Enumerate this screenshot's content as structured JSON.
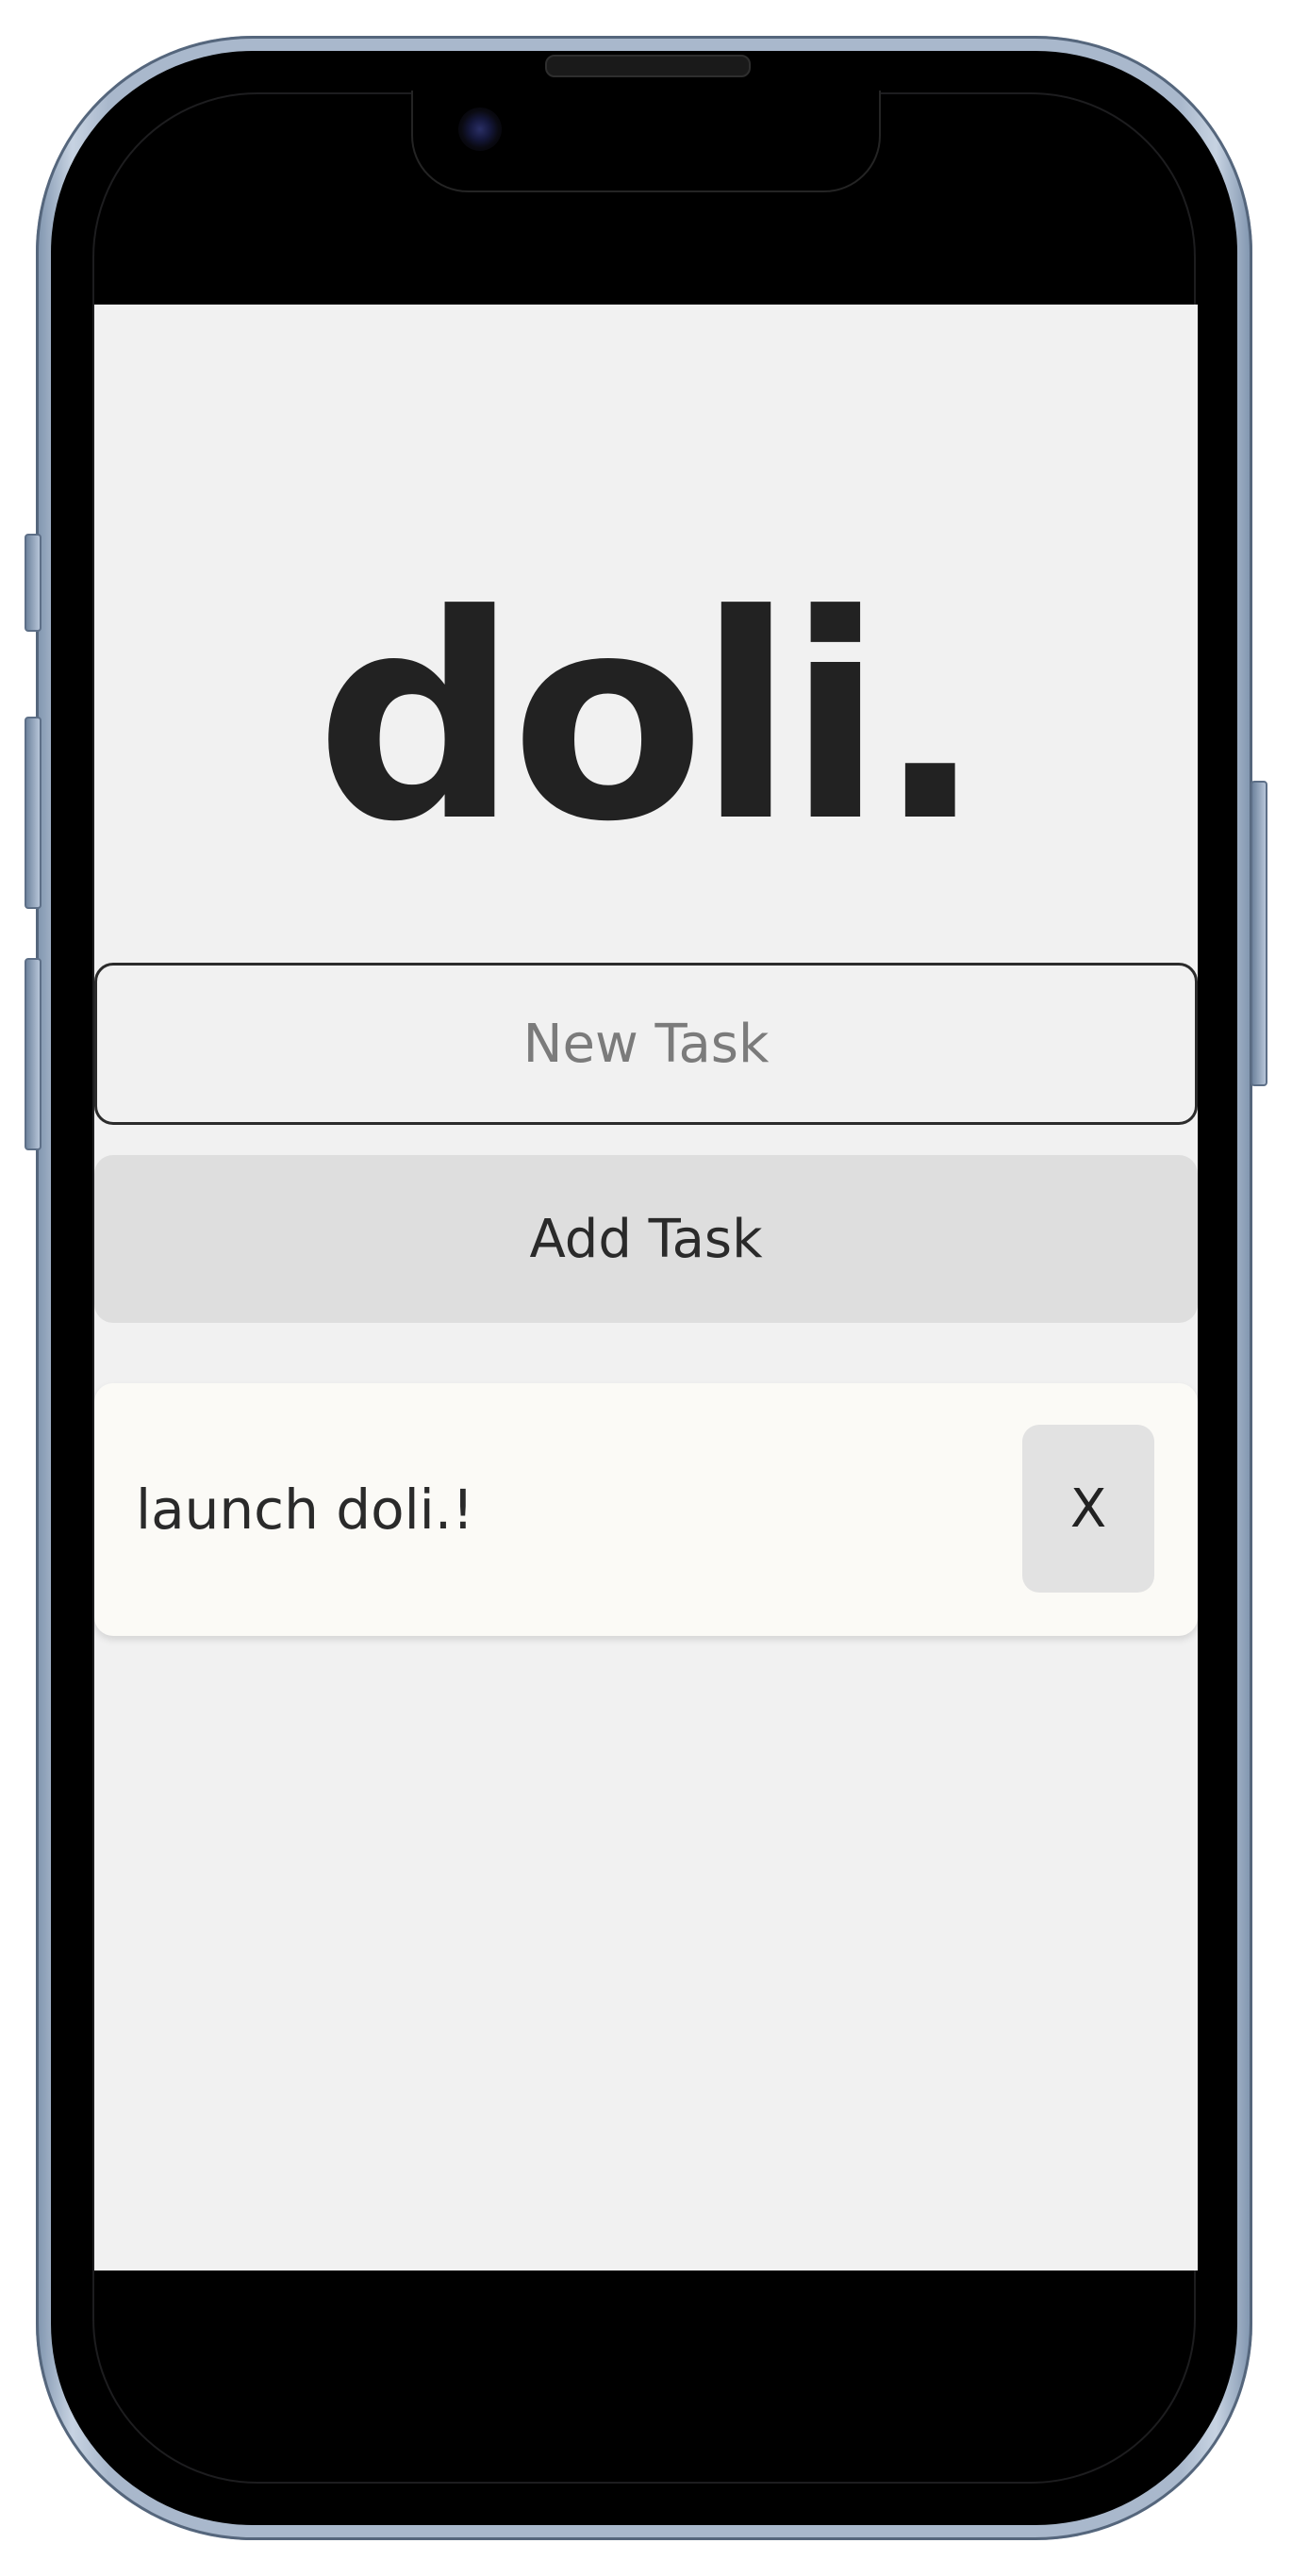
{
  "app": {
    "logo": "doli."
  },
  "new_task": {
    "placeholder": "New Task",
    "value": ""
  },
  "add_button": {
    "label": "Add Task"
  },
  "tasks": [
    {
      "text": "launch doli.!",
      "delete_label": "X"
    }
  ],
  "colors": {
    "background": "#f1f1f1",
    "logo": "#222222",
    "button": "#dedede",
    "card": "#fbfaf6"
  }
}
